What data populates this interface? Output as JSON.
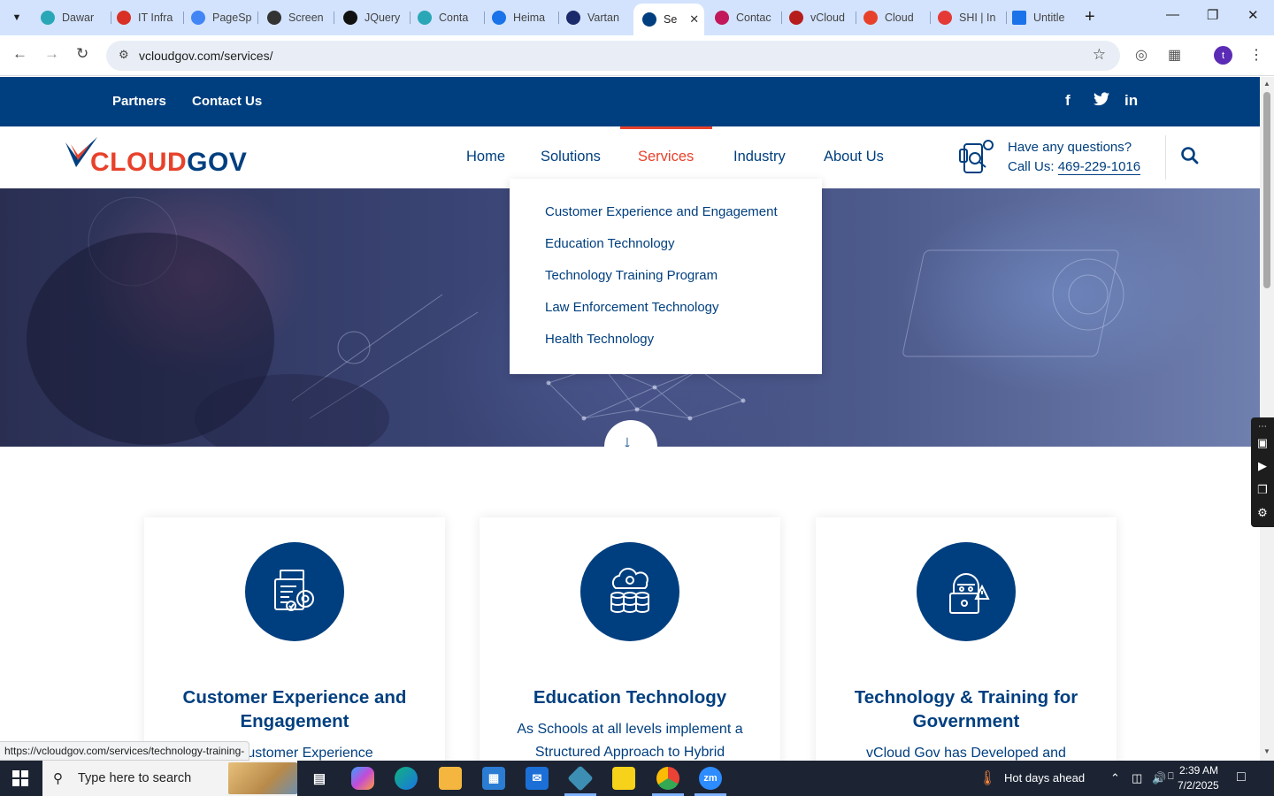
{
  "browser": {
    "tabs": [
      {
        "label": "Dawar",
        "favicon_color": "#2aa7b7"
      },
      {
        "label": "IT Infra",
        "favicon_color": "#d93025"
      },
      {
        "label": "PageSp",
        "favicon_color": "#4285f4"
      },
      {
        "label": "Screen",
        "favicon_color": "#333333"
      },
      {
        "label": "JQuery",
        "favicon_color": "#111111"
      },
      {
        "label": "Conta",
        "favicon_color": "#2aa7b7"
      },
      {
        "label": "Heima",
        "favicon_color": "#1a73e8"
      },
      {
        "label": "Vartan",
        "favicon_color": "#1b2a6b"
      },
      {
        "label": "Se",
        "favicon_color": "#003f7f",
        "active": true
      },
      {
        "label": "Contac",
        "favicon_color": "#c2185b"
      },
      {
        "label": "vCloud",
        "favicon_color": "#b71c1c"
      },
      {
        "label": "Cloud",
        "favicon_color": "#e8412b"
      },
      {
        "label": "SHI | In",
        "favicon_color": "#e53935"
      },
      {
        "label": "Untitle",
        "favicon_color": "#1a73e8"
      }
    ],
    "url": "vcloudgov.com/services/",
    "profile_initial": "t",
    "status_link": "https://vcloudgov.com/services/technology-training-"
  },
  "site": {
    "topbar": {
      "links": [
        "Partners",
        "Contact Us"
      ],
      "social": [
        "facebook-icon",
        "twitter-icon",
        "linkedin-icon"
      ]
    },
    "logo": {
      "part1": "CLOUD",
      "part2": "GOV"
    },
    "menu": [
      {
        "label": "Home"
      },
      {
        "label": "Solutions"
      },
      {
        "label": "Services",
        "active": true
      },
      {
        "label": "Industry"
      },
      {
        "label": "About Us"
      }
    ],
    "contact": {
      "question": "Have any questions?",
      "call_prefix": "Call Us: ",
      "phone": "469-229-1016"
    },
    "dropdown": [
      "Customer Experience and Engagement",
      "Education Technology",
      "Technology Training Program",
      "Law Enforcement Technology",
      "Health Technology"
    ],
    "cards": [
      {
        "title_line1": "Customer Experience and",
        "title_line2": "Engagement",
        "body_line1": "y's Customer Experience",
        "icon": "document-gear-icon"
      },
      {
        "title_line1": "Education Technology",
        "title_line2": "",
        "body_line1": "As Schools at all levels implement a",
        "body_line2": "Structured Approach to Hybrid",
        "icon": "cloud-database-icon"
      },
      {
        "title_line1": "Technology & Training for",
        "title_line2": "Government",
        "body_line1": "vCloud Gov has Developed and",
        "icon": "hacker-laptop-icon"
      }
    ],
    "colors": {
      "brand_blue": "#003f7f",
      "brand_red": "#e8412b"
    }
  },
  "taskbar": {
    "search_placeholder": "Type here to search",
    "weather": "Hot days ahead",
    "time": "2:39 AM",
    "date": "7/2/2025"
  }
}
